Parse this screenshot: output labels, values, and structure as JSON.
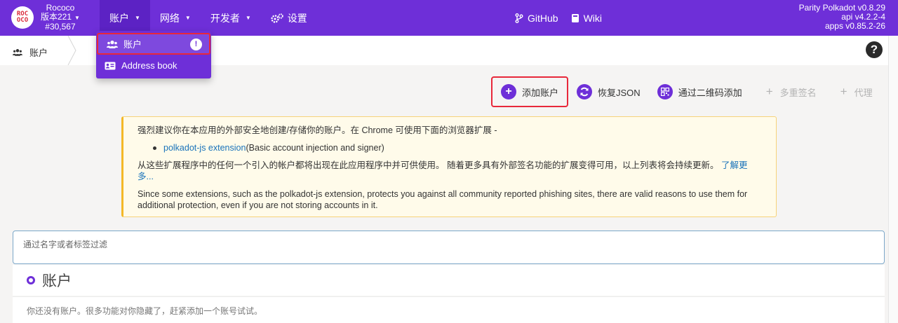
{
  "header": {
    "logo_text": "ROC OCO",
    "chain_name": "Rococo",
    "chain_version": "版本221",
    "block_number": "#30,567",
    "nav": [
      {
        "label": "账户"
      },
      {
        "label": "网络"
      },
      {
        "label": "开发者"
      },
      {
        "label": "设置"
      }
    ],
    "github_label": "GitHub",
    "wiki_label": "Wiki",
    "version_lines": [
      "Parity Polkadot v0.8.29",
      "api v4.2.2-4",
      "apps v0.85.2-26"
    ]
  },
  "dropdown": {
    "items": [
      {
        "label": "账户",
        "badge": "!"
      },
      {
        "label": "Address book"
      }
    ]
  },
  "breadcrumb": {
    "label": "账户",
    "help": "?"
  },
  "actions": {
    "add_account": "添加账户",
    "restore_json": "恢复JSON",
    "add_via_qr": "通过二维码添加",
    "multisig": "多重签名",
    "proxy": "代理"
  },
  "notice": {
    "line1": "强烈建议你在本应用的外部安全地创建/存储你的账户。在 Chrome 可使用下面的浏览器扩展 -",
    "ext_link": "polkadot-js extension",
    "ext_desc": " (Basic account injection and signer)",
    "line2": "从这些扩展程序中的任何一个引入的帐户都将出现在此应用程序中并可供使用。 随着更多具有外部签名功能的扩展变得可用，以上列表将会持续更新。",
    "learn_more": "了解更多...",
    "line3": "Since some extensions, such as the polkadot-js extension, protects you against all community reported phishing sites, there are valid reasons to use them for additional protection, even if you are not storing accounts in it."
  },
  "filter": {
    "placeholder": "通过名字或者标签过滤"
  },
  "accounts": {
    "title": "账户",
    "empty_text": "你还没有账户。很多功能对你隐藏了，赶紧添加一个账号试试。"
  },
  "colors": {
    "brand": "#6e2fd8",
    "highlight": "#e8283a",
    "notice_border": "#f4b827"
  }
}
